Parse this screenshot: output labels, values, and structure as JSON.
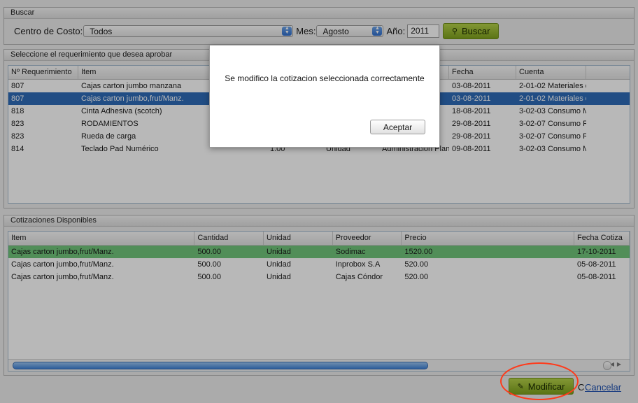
{
  "search": {
    "title": "Buscar",
    "cost_center_label": "Centro de Costo:",
    "cost_center_value": "Todos",
    "month_label": "Mes:",
    "month_value": "Agosto",
    "year_label": "Año:",
    "year_value": "2011",
    "search_button": "Buscar",
    "search_icon": "magnifier-icon"
  },
  "requirements": {
    "title": "Seleccione el requerimiento que desea aprobar",
    "columns": [
      "Nº Requerimiento",
      "Item",
      "",
      "",
      "",
      "Fecha",
      "Cuenta"
    ],
    "rows": [
      {
        "num": "807",
        "item": "Cajas carton jumbo manzana",
        "qty": "",
        "unit": "",
        "dept": "",
        "date": "03-08-2011",
        "account": "2-01-02 Materiales d",
        "selected": false
      },
      {
        "num": "807",
        "item": "Cajas carton jumbo,frut/Manz.",
        "qty": "",
        "unit": "",
        "dept": "",
        "date": "03-08-2011",
        "account": "2-01-02 Materiales d",
        "selected": true
      },
      {
        "num": "818",
        "item": "Cinta Adhesiva (scotch)",
        "qty": "",
        "unit": "",
        "dept": "",
        "date": "18-08-2011",
        "account": "3-02-03 Consumo M",
        "selected": false
      },
      {
        "num": "823",
        "item": "RODAMIENTOS",
        "qty": "",
        "unit": "",
        "dept": "",
        "date": "29-08-2011",
        "account": "3-02-07 Consumo R",
        "selected": false
      },
      {
        "num": "823",
        "item": "Rueda de carga",
        "qty": "",
        "unit": "",
        "dept": "",
        "date": "29-08-2011",
        "account": "3-02-07 Consumo R",
        "selected": false
      },
      {
        "num": "814",
        "item": "Teclado Pad Numérico",
        "qty": "1.00",
        "unit": "Unidad",
        "dept": "Administracion Plant",
        "date": "09-08-2011",
        "account": "3-02-03 Consumo M",
        "selected": false
      }
    ]
  },
  "quotes": {
    "title": "Cotizaciones Disponibles",
    "columns": [
      "Item",
      "Cantidad",
      "Unidad",
      "Proveedor",
      "Precio",
      "Fecha Cotiza"
    ],
    "rows": [
      {
        "item": "Cajas carton jumbo,frut/Manz.",
        "qty": "500.00",
        "unit": "Unidad",
        "supplier": "Sodimac",
        "price": "1520.00",
        "date": "17-10-2011",
        "highlight": true
      },
      {
        "item": "Cajas carton jumbo,frut/Manz.",
        "qty": "500.00",
        "unit": "Unidad",
        "supplier": "Inprobox S.A",
        "price": "520.00",
        "date": "05-08-2011",
        "highlight": false
      },
      {
        "item": "Cajas carton jumbo,frut/Manz.",
        "qty": "500.00",
        "unit": "Unidad",
        "supplier": "Cajas Cóndor",
        "price": "520.00",
        "date": "05-08-2011",
        "highlight": false
      }
    ]
  },
  "actions": {
    "modify_button": "Modificar",
    "cancel_link": "Cancelar",
    "stray_char": "C",
    "modify_icon": "pencil-icon"
  },
  "dialog": {
    "message": "Se modifico la cotizacion seleccionada correctamente",
    "accept_button": "Aceptar"
  },
  "colors": {
    "selected_row": "#2f6bb8",
    "highlight_row": "#71c57a",
    "accent_green": "#8fb02a",
    "annotation_ring": "#ff3a1a"
  }
}
